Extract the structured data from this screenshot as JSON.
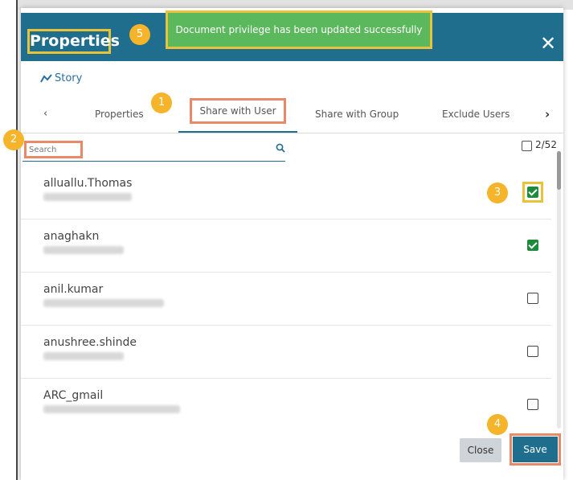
{
  "dialog": {
    "title": "Properties",
    "close_glyph": "✕"
  },
  "toast": {
    "message": "Document privilege has been updated successfully"
  },
  "breadcrumb": {
    "story_label": "Story"
  },
  "tabs": {
    "prev_glyph": "‹",
    "next_glyph": "›",
    "items": [
      {
        "label": "Properties"
      },
      {
        "label": "Share with User",
        "active": true
      },
      {
        "label": "Share with Group"
      },
      {
        "label": "Exclude Users"
      }
    ]
  },
  "search": {
    "placeholder": "Search",
    "selected_count": "2/52"
  },
  "users": [
    {
      "name": "alluallu.Thomas",
      "checked": true
    },
    {
      "name": "anaghakn",
      "checked": true
    },
    {
      "name": "anil.kumar",
      "checked": false
    },
    {
      "name": "anushree.shinde",
      "checked": false
    },
    {
      "name": "ARC_gmail",
      "checked": false
    }
  ],
  "footer": {
    "close_label": "Close",
    "save_label": "Save"
  },
  "badges": {
    "tab": "1",
    "search": "2",
    "checkbox": "3",
    "save": "4",
    "toast": "5"
  },
  "colors": {
    "header": "#1f6e8e",
    "toast": "#5cb85c",
    "highlight_yellow": "#e8c33a",
    "highlight_orange": "#e8896a",
    "badge": "#f5b42a",
    "checkbox_checked": "#1e8a3c"
  }
}
